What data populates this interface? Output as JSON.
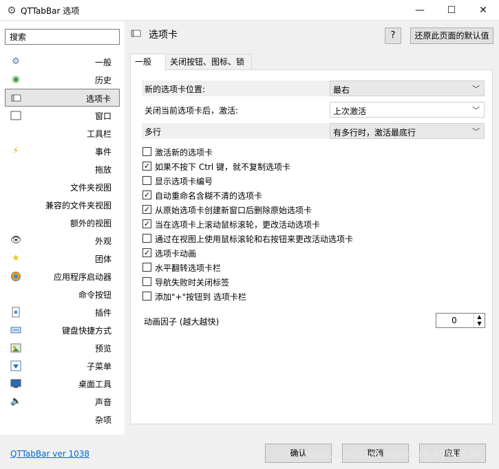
{
  "window": {
    "title": "QTTabBar 选项",
    "app_icon": "gear-icon",
    "minimize_glyph": "—",
    "maximize_glyph": "☐",
    "close_glyph": "✕"
  },
  "sidebar": {
    "search_value": "搜索",
    "items": [
      {
        "label": "一般",
        "icon": "gear-icon"
      },
      {
        "label": "历史",
        "icon": "history-icon"
      },
      {
        "label": "选项卡",
        "icon": "tab-icon",
        "selected": true
      },
      {
        "label": "窗口",
        "icon": "window-icon"
      },
      {
        "label": "工具栏",
        "icon": ""
      },
      {
        "label": "事件",
        "icon": "lightning-icon"
      },
      {
        "label": "拖放",
        "icon": ""
      },
      {
        "label": "文件夹视图",
        "icon": ""
      },
      {
        "label": "兼容的文件夹视图",
        "icon": ""
      },
      {
        "label": "额外的视图",
        "icon": ""
      },
      {
        "label": "外观",
        "icon": "eye-icon"
      },
      {
        "label": "团体",
        "icon": "star-icon"
      },
      {
        "label": "应用程序启动器",
        "icon": "launcher-icon"
      },
      {
        "label": "命令按钮",
        "icon": ""
      },
      {
        "label": "插件",
        "icon": "plugin-icon"
      },
      {
        "label": "键盘快捷方式",
        "icon": "keyboard-icon"
      },
      {
        "label": "预览",
        "icon": "preview-icon"
      },
      {
        "label": "子菜单",
        "icon": "submenu-icon"
      },
      {
        "label": "桌面工具",
        "icon": "desktop-icon"
      },
      {
        "label": "声音",
        "icon": "speaker-icon"
      },
      {
        "label": "杂项",
        "icon": ""
      }
    ]
  },
  "header": {
    "title": "选项卡",
    "help_label": "?",
    "reset_label": "还原此页面的默认值"
  },
  "tabs": [
    {
      "label": "一般",
      "active": true
    },
    {
      "label": "关闭按钮、图标、锁",
      "active": false
    }
  ],
  "settings": {
    "dropdowns": [
      {
        "label": "新的选项卡位置:",
        "value": "最右"
      },
      {
        "label": "关闭当前选项卡后，激活:",
        "value": "上次激活"
      },
      {
        "label": "多行",
        "value": "有多行时，激活最底行"
      }
    ],
    "checkboxes": [
      {
        "label": "激活新的选项卡",
        "checked": false
      },
      {
        "label": "如果不按下 Ctrl 键，就不复制选项卡",
        "checked": true
      },
      {
        "label": "显示选项卡编号",
        "checked": false
      },
      {
        "label": "自动重命名含糊不清的选项卡",
        "checked": true
      },
      {
        "label": "从原始选项卡创建新窗口后删除原始选项卡",
        "checked": true
      },
      {
        "label": "当在选项卡上滚动鼠标滚轮，更改活动选项卡",
        "checked": true
      },
      {
        "label": "通过在视图上使用鼠标滚轮和右按钮来更改活动选项卡",
        "checked": false
      },
      {
        "label": "选项卡动画",
        "checked": true
      },
      {
        "label": "水平翻转选项卡栏",
        "checked": false
      },
      {
        "label": "导航失败时关闭标签",
        "checked": false
      },
      {
        "label": "添加\"+\"按钮到 选项卡栏",
        "checked": false
      }
    ],
    "animation_factor_label": "动画因子 (越大越快)",
    "animation_factor_value": "0"
  },
  "footer": {
    "version_link": "QTTabBar ver 1038",
    "ok_label": "确认",
    "cancel_label": "取消",
    "apply_label": "应用",
    "watermark": "https://blog.csdn.net/weixin_40511198"
  },
  "colors": {
    "link": "#0066cc",
    "selected_bg": "#e5e5e5",
    "accent": "#f0c020"
  }
}
